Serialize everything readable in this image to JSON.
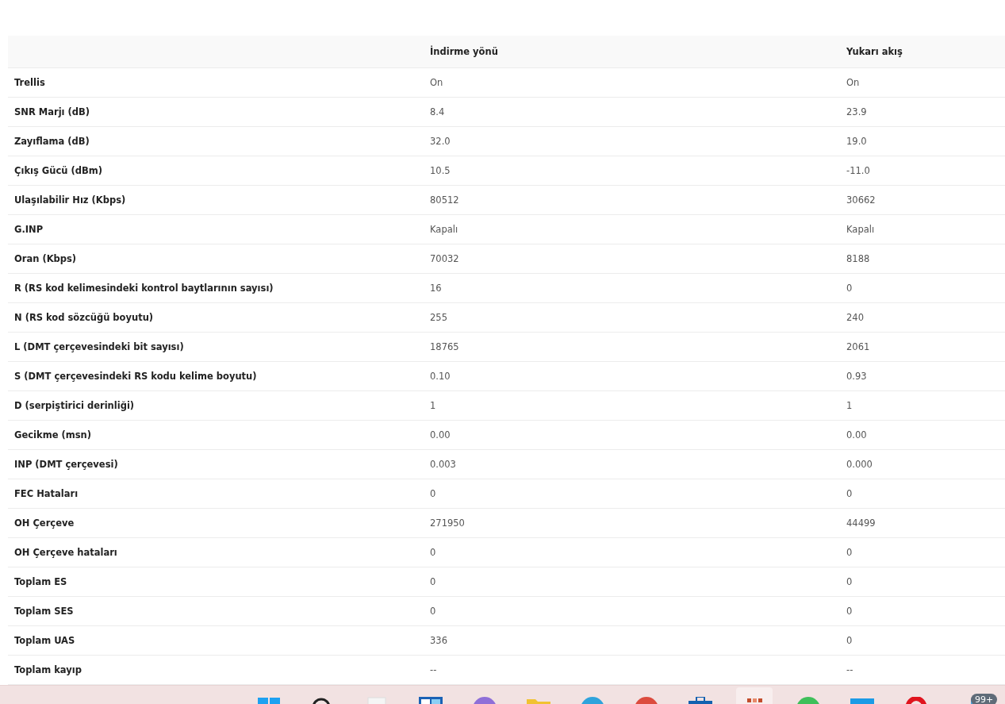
{
  "table": {
    "columns": [
      "",
      "İndirme yönü",
      "Yukarı akış"
    ],
    "rows": [
      [
        "Trellis",
        "On",
        "On"
      ],
      [
        "SNR Marjı (dB)",
        "8.4",
        "23.9"
      ],
      [
        "Zayıflama (dB)",
        "32.0",
        "19.0"
      ],
      [
        "Çıkış Gücü (dBm)",
        "10.5",
        "-11.0"
      ],
      [
        "Ulaşılabilir Hız (Kbps)",
        "80512",
        "30662"
      ],
      [
        "G.INP",
        "Kapalı",
        "Kapalı"
      ],
      [
        "Oran (Kbps)",
        "70032",
        "8188"
      ],
      [
        "R (RS kod kelimesindeki kontrol baytlarının sayısı)",
        "16",
        "0"
      ],
      [
        "N (RS kod sözcüğü boyutu)",
        "255",
        "240"
      ],
      [
        "L (DMT çerçevesindeki bit sayısı)",
        "18765",
        "2061"
      ],
      [
        "S (DMT çerçevesindeki RS kodu kelime boyutu)",
        "0.10",
        "0.93"
      ],
      [
        "D (serpiştirici derinliği)",
        "1",
        "1"
      ],
      [
        "Gecikme (msn)",
        "0.00",
        "0.00"
      ],
      [
        "INP (DMT çerçevesi)",
        "0.003",
        "0.000"
      ],
      [
        "FEC Hataları",
        "0",
        "0"
      ],
      [
        "OH Çerçeve",
        "271950",
        "44499"
      ],
      [
        "OH Çerçeve hataları",
        "0",
        "0"
      ],
      [
        "Toplam ES",
        "0",
        "0"
      ],
      [
        "Toplam SES",
        "0",
        "0"
      ],
      [
        "Toplam UAS",
        "336",
        "0"
      ],
      [
        "Toplam kayıp",
        "--",
        "--"
      ]
    ]
  },
  "taskbar": {
    "icons": [
      {
        "kind": "start",
        "selected": false
      },
      {
        "kind": "search",
        "selected": false
      },
      {
        "kind": "file",
        "selected": false
      },
      {
        "kind": "widgets",
        "selected": false
      },
      {
        "kind": "circle",
        "color": "#8f6fd8",
        "selected": false
      },
      {
        "kind": "folder",
        "selected": false
      },
      {
        "kind": "circle",
        "color": "#2fa3dc",
        "selected": false
      },
      {
        "kind": "circle",
        "color": "#dc4b3e",
        "selected": false
      },
      {
        "kind": "briefcase",
        "selected": false
      },
      {
        "kind": "app",
        "selected": true
      },
      {
        "kind": "circle",
        "color": "#3fbf5a",
        "selected": false
      },
      {
        "kind": "window",
        "selected": false
      },
      {
        "kind": "ring",
        "selected": false
      },
      {
        "kind": "badged",
        "badge": "99+",
        "selected": false
      }
    ]
  }
}
